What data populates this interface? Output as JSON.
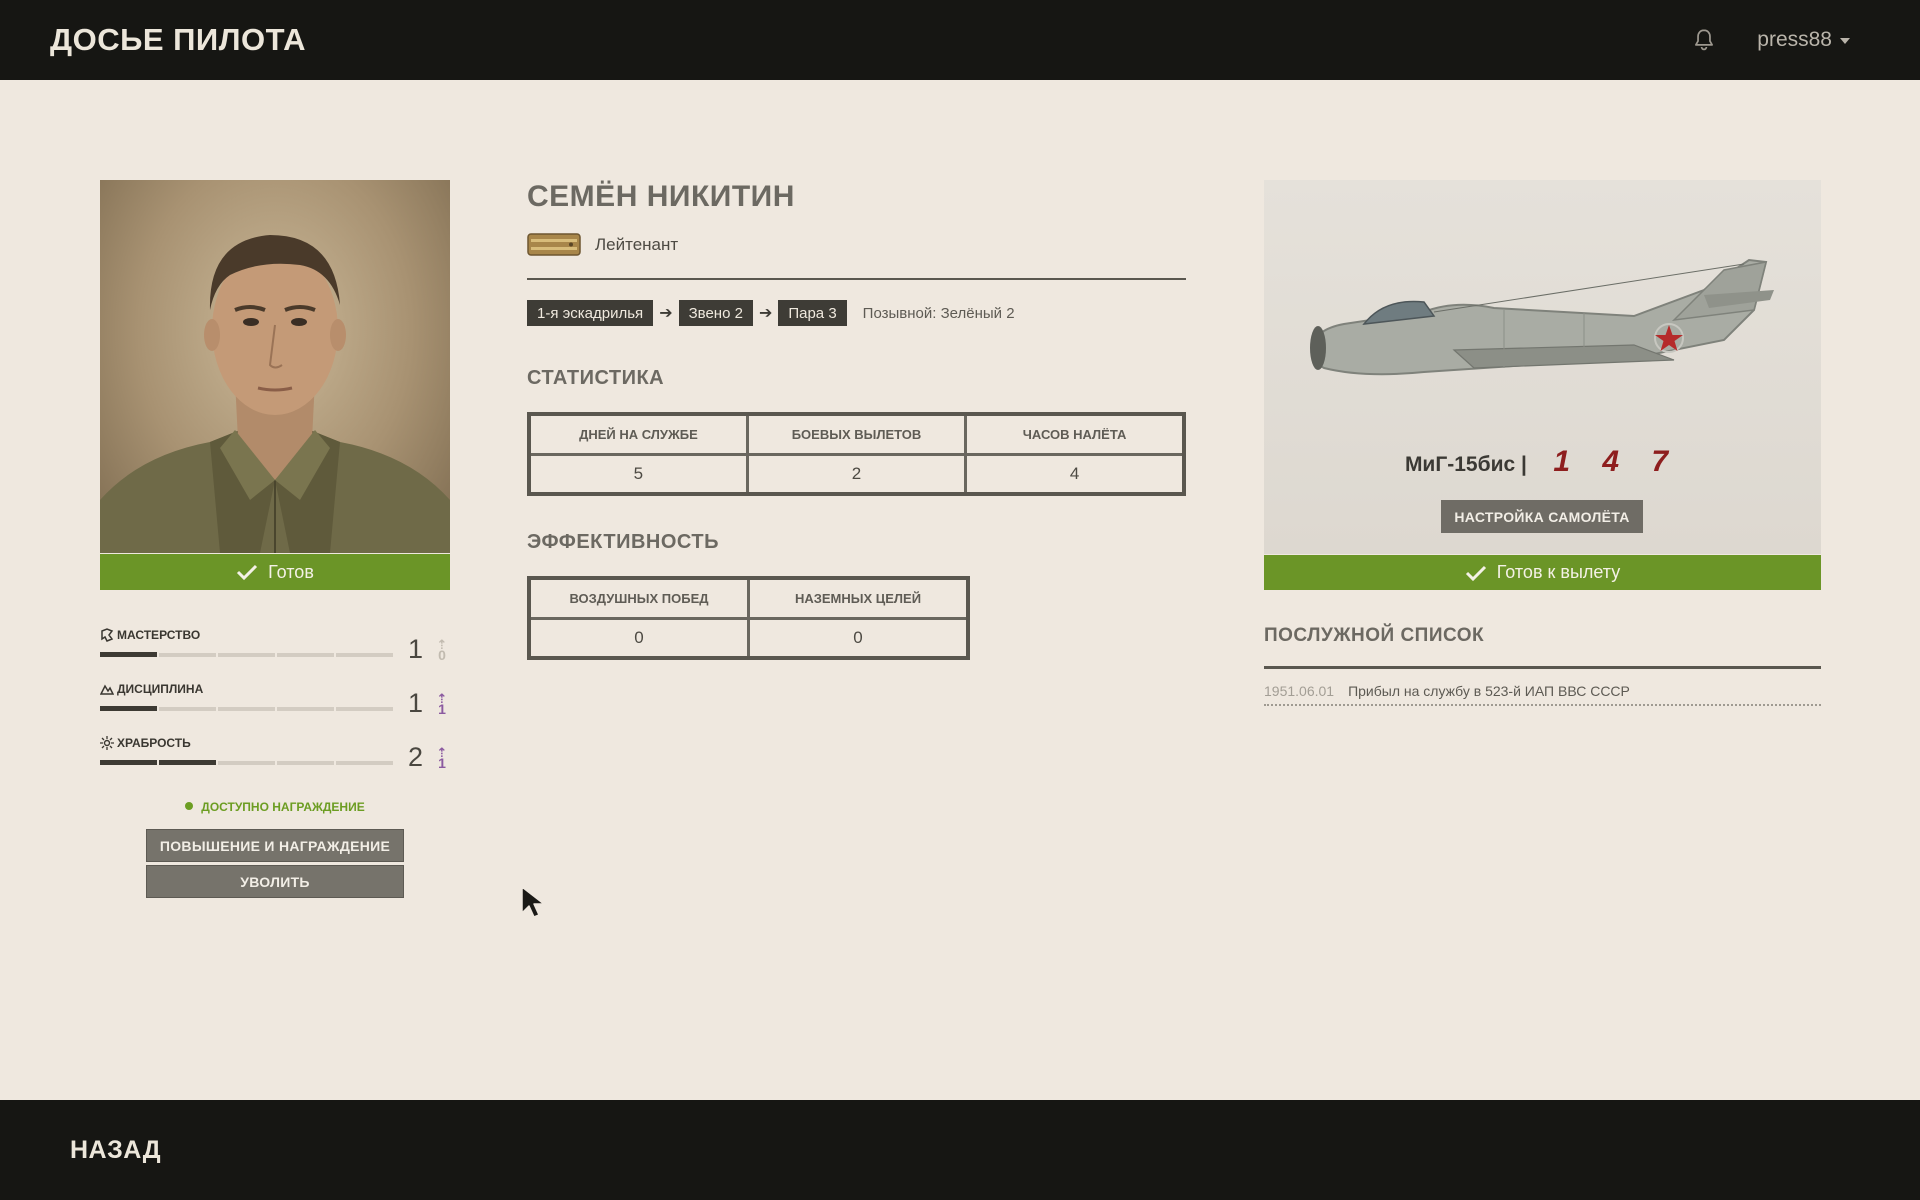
{
  "header": {
    "app_title": "ДОСЬЕ ПИЛОТА",
    "notifications_icon": "bell-icon",
    "username": "press88"
  },
  "footer": {
    "back_label": "НАЗАД"
  },
  "pilot": {
    "name": "СЕМЁН НИКИТИН",
    "rank": "Лейтенант",
    "status": "Готов",
    "unit_path": [
      "1-я эскадрилья",
      "Звено 2",
      "Пара 3"
    ],
    "callsign": "Позывной: Зелёный 2"
  },
  "skills": [
    {
      "label": "МАСТЕРСТВО",
      "value": "1",
      "level_fraction": 0.2,
      "upgrade": "0",
      "upgrade_available": false
    },
    {
      "label": "ДИСЦИПЛИНА",
      "value": "1",
      "level_fraction": 0.2,
      "upgrade": "1",
      "upgrade_available": true
    },
    {
      "label": "ХРАБРОСТЬ",
      "value": "2",
      "level_fraction": 0.4,
      "upgrade": "1",
      "upgrade_available": true
    }
  ],
  "award_note": "ДОСТУПНО НАГРАЖДЕНИЕ",
  "actions": {
    "promote_label": "ПОВЫШЕНИЕ И НАГРАЖДЕНИЕ",
    "dismiss_label": "УВОЛИТЬ"
  },
  "statistics": {
    "title": "СТАТИСТИКА",
    "headers": [
      "ДНЕЙ НА СЛУЖБЕ",
      "БОЕВЫХ ВЫЛЕТОВ",
      "ЧАСОВ НАЛЁТА"
    ],
    "values": [
      "5",
      "2",
      "4"
    ]
  },
  "efficiency": {
    "title": "ЭФФЕКТИВНОСТЬ",
    "headers": [
      "ВОЗДУШНЫХ ПОБЕД",
      "НАЗЕМНЫХ ЦЕЛЕЙ"
    ],
    "values": [
      "0",
      "0"
    ]
  },
  "aircraft": {
    "model": "МиГ-15бис |",
    "number": "147",
    "setup_label": "НАСТРОЙКА САМОЛЁТА",
    "status": "Готов к вылету"
  },
  "service_record": {
    "title": "ПОСЛУЖНОЙ СПИСОК",
    "entries": [
      {
        "date": "1951.06.01",
        "text": "Прибыл на службу в 523-й ИАП ВВС СССР"
      }
    ]
  },
  "colors": {
    "accent_green": "#6b9527",
    "background": "#efe8df",
    "bar_dark": "#161613",
    "tail_number_red": "#8e1e1e",
    "upgrade_purple": "#8b5aa0"
  }
}
